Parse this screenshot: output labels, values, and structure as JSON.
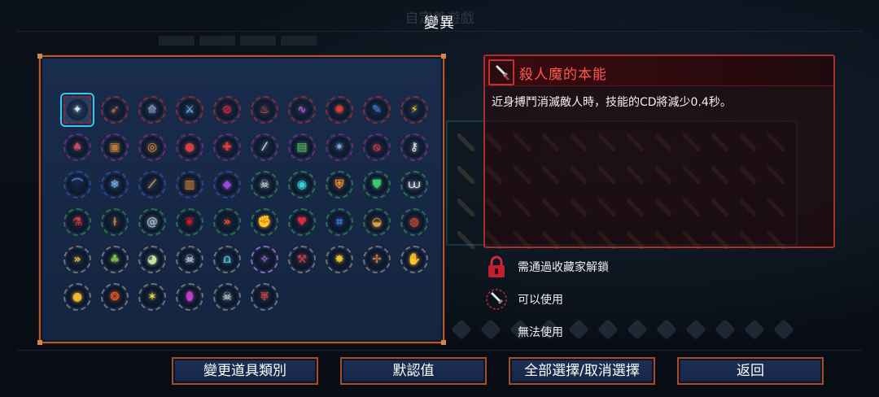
{
  "background": {
    "ghost_title": "自定義遊戲"
  },
  "dialog": {
    "title": "變異"
  },
  "grid": {
    "rows": [
      [
        {
          "icon": "dagger-icon",
          "ring": "#9a2a2a",
          "color": "#d8e4f0",
          "glyph": "✦",
          "selected": true
        },
        {
          "icon": "bow-icon",
          "ring": "#9a2a2a",
          "color": "#c9703a",
          "glyph": "➶"
        },
        {
          "icon": "arrows-icon",
          "ring": "#9a2a2a",
          "color": "#7a8fb8",
          "glyph": "⟰"
        },
        {
          "icon": "frost-blade-icon",
          "ring": "#9a2a2a",
          "color": "#7fb8e8",
          "glyph": "⚔"
        },
        {
          "icon": "no-sign-icon",
          "ring": "#9a2a2a",
          "color": "#c82a3a",
          "glyph": "⊘"
        },
        {
          "icon": "potion-icon",
          "ring": "#9a2a2a",
          "color": "#e06a3a",
          "glyph": "♨"
        },
        {
          "icon": "snake-weapon-icon",
          "ring": "#9a2a2a",
          "color": "#a85ac8",
          "glyph": "∿"
        },
        {
          "icon": "orb-icon",
          "ring": "#9a2a2a",
          "color": "#e04030",
          "glyph": "✺"
        },
        {
          "icon": "scroll-icon",
          "ring": "#9a2a2a",
          "color": "#3a8ad8",
          "glyph": "✎"
        },
        {
          "icon": "lightning-icon",
          "ring": "#9a2a2a",
          "color": "#f0c030",
          "glyph": "⚡"
        }
      ],
      [
        {
          "icon": "mushroom-icon",
          "ring": "#7a2a7a",
          "color": "#c84a6a",
          "glyph": "♠"
        },
        {
          "icon": "barrel-icon",
          "ring": "#7a2a7a",
          "color": "#b87a3a",
          "glyph": "▣"
        },
        {
          "icon": "ring-icon",
          "ring": "#7a2a7a",
          "color": "#e08a3a",
          "glyph": "◎"
        },
        {
          "icon": "grenade-icon",
          "ring": "#7a2a7a",
          "color": "#d04040",
          "glyph": "●"
        },
        {
          "icon": "cross-star-icon",
          "ring": "#7a2a7a",
          "color": "#e03a3a",
          "glyph": "✚"
        },
        {
          "icon": "sword-swipe-icon",
          "ring": "#7a2a7a",
          "color": "#c8d8f0",
          "glyph": "⁄"
        },
        {
          "icon": "tome-icon",
          "ring": "#7a2a7a",
          "color": "#5ab86a",
          "glyph": "▤"
        },
        {
          "icon": "star-burst-icon",
          "ring": "#7a2a7a",
          "color": "#8ab0e8",
          "glyph": "✴"
        },
        {
          "icon": "no-target-icon",
          "ring": "#7a2a7a",
          "color": "#d03a3a",
          "glyph": "⦸"
        },
        {
          "icon": "key-icon",
          "ring": "#7a2a7a",
          "color": "#e8e8e8",
          "glyph": "⚷"
        }
      ],
      [
        {
          "icon": "blue-arc-icon",
          "ring": "#2a4a9a",
          "color": "#3a7ad8",
          "glyph": "⌒"
        },
        {
          "icon": "frost-bow-icon",
          "ring": "#2a4a9a",
          "color": "#7ab8e8",
          "glyph": "❄"
        },
        {
          "icon": "whip-icon",
          "ring": "#2a4a9a",
          "color": "#c8a060",
          "glyph": "⟋"
        },
        {
          "icon": "shield-chest-icon",
          "ring": "#2a4a9a",
          "color": "#c87a3a",
          "glyph": "▥"
        },
        {
          "icon": "purple-drop-icon",
          "ring": "#2a4a9a",
          "color": "#9a4ad8",
          "glyph": "◆"
        },
        {
          "icon": "skull-cross-icon",
          "ring": "#2a7a4a",
          "color": "#e0e0e0",
          "glyph": "☠"
        },
        {
          "icon": "blue-orb-icon",
          "ring": "#2a7a4a",
          "color": "#3ad0d8",
          "glyph": "◉"
        },
        {
          "icon": "orange-shield-icon",
          "ring": "#2a7a4a",
          "color": "#e08a2a",
          "glyph": "⛨"
        },
        {
          "icon": "green-shield-icon",
          "ring": "#2a7a4a",
          "color": "#3ac86a",
          "glyph": "⛊"
        },
        {
          "icon": "fangs-icon",
          "ring": "#2a7a4a",
          "color": "#e0e0e0",
          "glyph": "⩊"
        }
      ],
      [
        {
          "icon": "red-flask-icon",
          "ring": "#2a7a4a",
          "color": "#d83a3a",
          "glyph": "⚗"
        },
        {
          "icon": "staff-icon",
          "ring": "#2a7a4a",
          "color": "#e0903a",
          "glyph": "⟊"
        },
        {
          "icon": "spiral-shell-icon",
          "ring": "#2a7a4a",
          "color": "#a0b0c0",
          "glyph": "@"
        },
        {
          "icon": "blood-drop-icon",
          "ring": "#2a7a4a",
          "color": "#c81a2a",
          "glyph": "❦"
        },
        {
          "icon": "fast-forward-icon",
          "ring": "#2a7a4a",
          "color": "#f05a1a",
          "glyph": "»"
        },
        {
          "icon": "fist-shield-icon",
          "ring": "#2a7a4a",
          "color": "#c8a070",
          "glyph": "✊"
        },
        {
          "icon": "heart-armor-icon",
          "ring": "#2a7a4a",
          "color": "#d82a3a",
          "glyph": "♥"
        },
        {
          "icon": "rune-grid-icon",
          "ring": "#2a7a4a",
          "color": "#3a7ad8",
          "glyph": "⌗"
        },
        {
          "icon": "green-blob-icon",
          "ring": "#2a7a4a",
          "color": "#e0a03a",
          "glyph": "◒"
        },
        {
          "icon": "bomb-icon",
          "ring": "#2a7a4a",
          "color": "#d84a2a",
          "glyph": "◍"
        }
      ],
      [
        {
          "icon": "double-chevron-icon",
          "ring": "#7a7a7a",
          "color": "#f0c03a",
          "glyph": "»"
        },
        {
          "icon": "green-wisp-icon",
          "ring": "#7a7a7a",
          "color": "#7ab84a",
          "glyph": "♣"
        },
        {
          "icon": "owl-face-icon",
          "ring": "#7a7a7a",
          "color": "#c8e0a0",
          "glyph": "◕"
        },
        {
          "icon": "skull-icon",
          "ring": "#7a7a7a",
          "color": "#e0e8f0",
          "glyph": "☠"
        },
        {
          "icon": "teeth-icon",
          "ring": "#7a7a7a",
          "color": "#5ad0e8",
          "glyph": "⩍"
        },
        {
          "icon": "magic-circle-icon",
          "ring": "#9a6ac8",
          "color": "#b87ae8",
          "glyph": "✧"
        },
        {
          "icon": "battle-axe-icon",
          "ring": "#7a7a7a",
          "color": "#c84040",
          "glyph": "⚒"
        },
        {
          "icon": "sparkle-icon",
          "ring": "#7a7a7a",
          "color": "#f0c030",
          "glyph": "✸"
        },
        {
          "icon": "whirl-blade-icon",
          "ring": "#7a7a7a",
          "color": "#d07a3a",
          "glyph": "✢"
        },
        {
          "icon": "gold-gauntlet-icon",
          "ring": "#7a7a7a",
          "color": "#f0b82a",
          "glyph": "✋"
        }
      ],
      [
        {
          "icon": "gold-coin-icon",
          "ring": "#7a7a7a",
          "color": "#f0b82a",
          "glyph": "●"
        },
        {
          "icon": "fire-feather-icon",
          "ring": "#7a7a7a",
          "color": "#f05a1a",
          "glyph": "❂"
        },
        {
          "icon": "lightning-slash-icon",
          "ring": "#7a7a7a",
          "color": "#f0d04a",
          "glyph": "✶"
        },
        {
          "icon": "magenta-potion-icon",
          "ring": "#7a7a7a",
          "color": "#c83ac8",
          "glyph": "⬮"
        },
        {
          "icon": "horned-skull-icon",
          "ring": "#7a7a7a",
          "color": "#e0e0e0",
          "glyph": "☠"
        },
        {
          "icon": "demon-face-icon",
          "ring": "#7a7a7a",
          "color": "#d84a4a",
          "glyph": "♅"
        }
      ]
    ]
  },
  "detail": {
    "icon": "dagger-icon",
    "title": "殺人魔的本能",
    "description": "近身搏鬥消滅敵人時，技能的CD將減少0.4秒。"
  },
  "legend": {
    "locked": "需通過收藏家解鎖",
    "usable": "可以使用",
    "unusable": "無法使用"
  },
  "buttons": {
    "change_category": "變更道具類別",
    "default": "默認值",
    "toggle_all": "全部選擇/取消選擇",
    "back": "返回"
  },
  "colors": {
    "panel_border": "#b25a2a",
    "detail_border": "#a8302a",
    "detail_title": "#ff5a4c",
    "selection": "#38c6f0"
  }
}
